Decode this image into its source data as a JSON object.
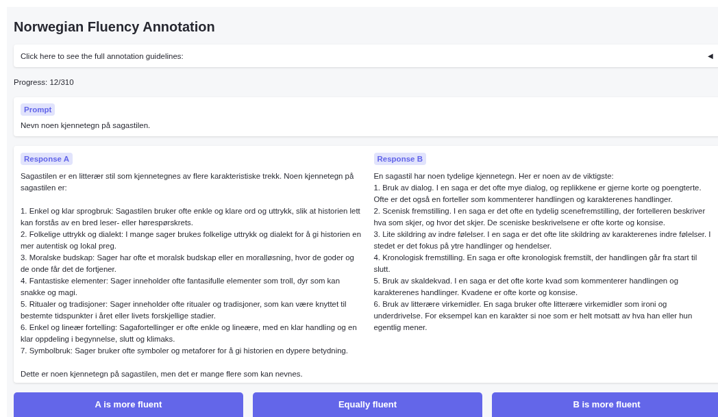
{
  "title": "Norwegian Fluency Annotation",
  "guidelines": {
    "label": "Click here to see the full annotation guidelines:",
    "toggle": "◀"
  },
  "progress": "Progress: 12/310",
  "prompt": {
    "badge": "Prompt",
    "text": "Nevn noen kjennetegn på sagastilen."
  },
  "responses": [
    {
      "badge": "Response A",
      "blocks": [
        [
          "Sagastilen er en litterær stil som kjennetegnes av flere karakteristiske trekk. Noen kjennetegn på sagastilen er:"
        ],
        [
          "1. Enkel og klar sprogbruk: Sagastilen bruker ofte enkle og klare ord og uttrykk, slik at historien lett kan forstås av en bred leser- eller hørespørskrets.",
          "2. Folkelige uttrykk og dialekt: I mange sager brukes folkelige uttrykk og dialekt for å gi historien en mer autentisk og lokal preg.",
          "3. Moralske budskap: Sager har ofte et moralsk budskap eller en moralløsning, hvor de goder og de onde får det de fortjener.",
          "4. Fantastiske elementer: Sager inneholder ofte fantasifulle elementer som troll, dyr som kan snakke og magi.",
          "5. Ritualer og tradisjoner: Sager inneholder ofte ritualer og tradisjoner, som kan være knyttet til bestemte tidspunkter i året eller livets forskjellige stadier.",
          "6. Enkel og lineær fortelling: Sagafortellinger er ofte enkle og lineære, med en klar handling og en klar oppdeling i begynnelse, slutt og klimaks.",
          "7. Symbolbruk: Sager bruker ofte symboler og metaforer for å gi historien en dypere betydning."
        ],
        [
          "Dette er noen kjennetegn på sagastilen, men det er mange flere som kan nevnes."
        ]
      ]
    },
    {
      "badge": "Response B",
      "blocks": [
        [
          "En sagastil har noen tydelige kjennetegn. Her er noen av de viktigste:",
          "1. Bruk av dialog. I en saga er det ofte mye dialog, og replikkene er gjerne korte og poengterte. Ofte er det også en forteller som kommenterer handlingen og karakterenes handlinger.",
          "2. Scenisk fremstilling. I en saga er det ofte en tydelig scenefremstilling, der fortelleren beskriver hva som skjer, og hvor det skjer. De sceniske beskrivelsene er ofte korte og konsise.",
          "3. Lite skildring av indre følelser. I en saga er det ofte lite skildring av karakterenes indre følelser. I stedet er det fokus på ytre handlinger og hendelser.",
          "4. Kronologisk fremstilling. En saga er ofte kronologisk fremstilt, der handlingen går fra start til slutt.",
          "5. Bruk av skaldekvad. I en saga er det ofte korte kvad som kommenterer handlingen og karakterenes handlinger. Kvadene er ofte korte og konsise.",
          "6. Bruk av litterære virkemidler. En saga bruker ofte litterære virkemidler som ironi og underdrivelse. For eksempel kan en karakter si noe som er helt motsatt av hva han eller hun egentlig mener."
        ]
      ]
    }
  ],
  "buttons": [
    "A is more fluent",
    "Equally fluent",
    "B is more fluent"
  ]
}
